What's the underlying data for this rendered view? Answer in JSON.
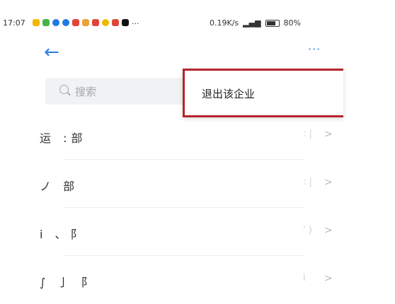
{
  "status_bar": {
    "time": "17:07",
    "network_speed": "0.19K/s",
    "battery": "80%",
    "battery_level": 0.8
  },
  "header": {
    "back_icon": "arrow-left-icon",
    "more_label": "···"
  },
  "search": {
    "placeholder": "搜索"
  },
  "menu": {
    "items": [
      {
        "label": "退出该企业"
      }
    ]
  },
  "departments": [
    {
      "label": "运 :部",
      "count": ": |"
    },
    {
      "label": "ノ 部",
      "count": ": |"
    },
    {
      "label": "i 、阝",
      "count": "' )"
    },
    {
      "label": "∫ 亅 阝",
      "count": "i"
    }
  ],
  "colors": {
    "accent": "#2f7fe0",
    "highlight_border": "#b3262b"
  }
}
